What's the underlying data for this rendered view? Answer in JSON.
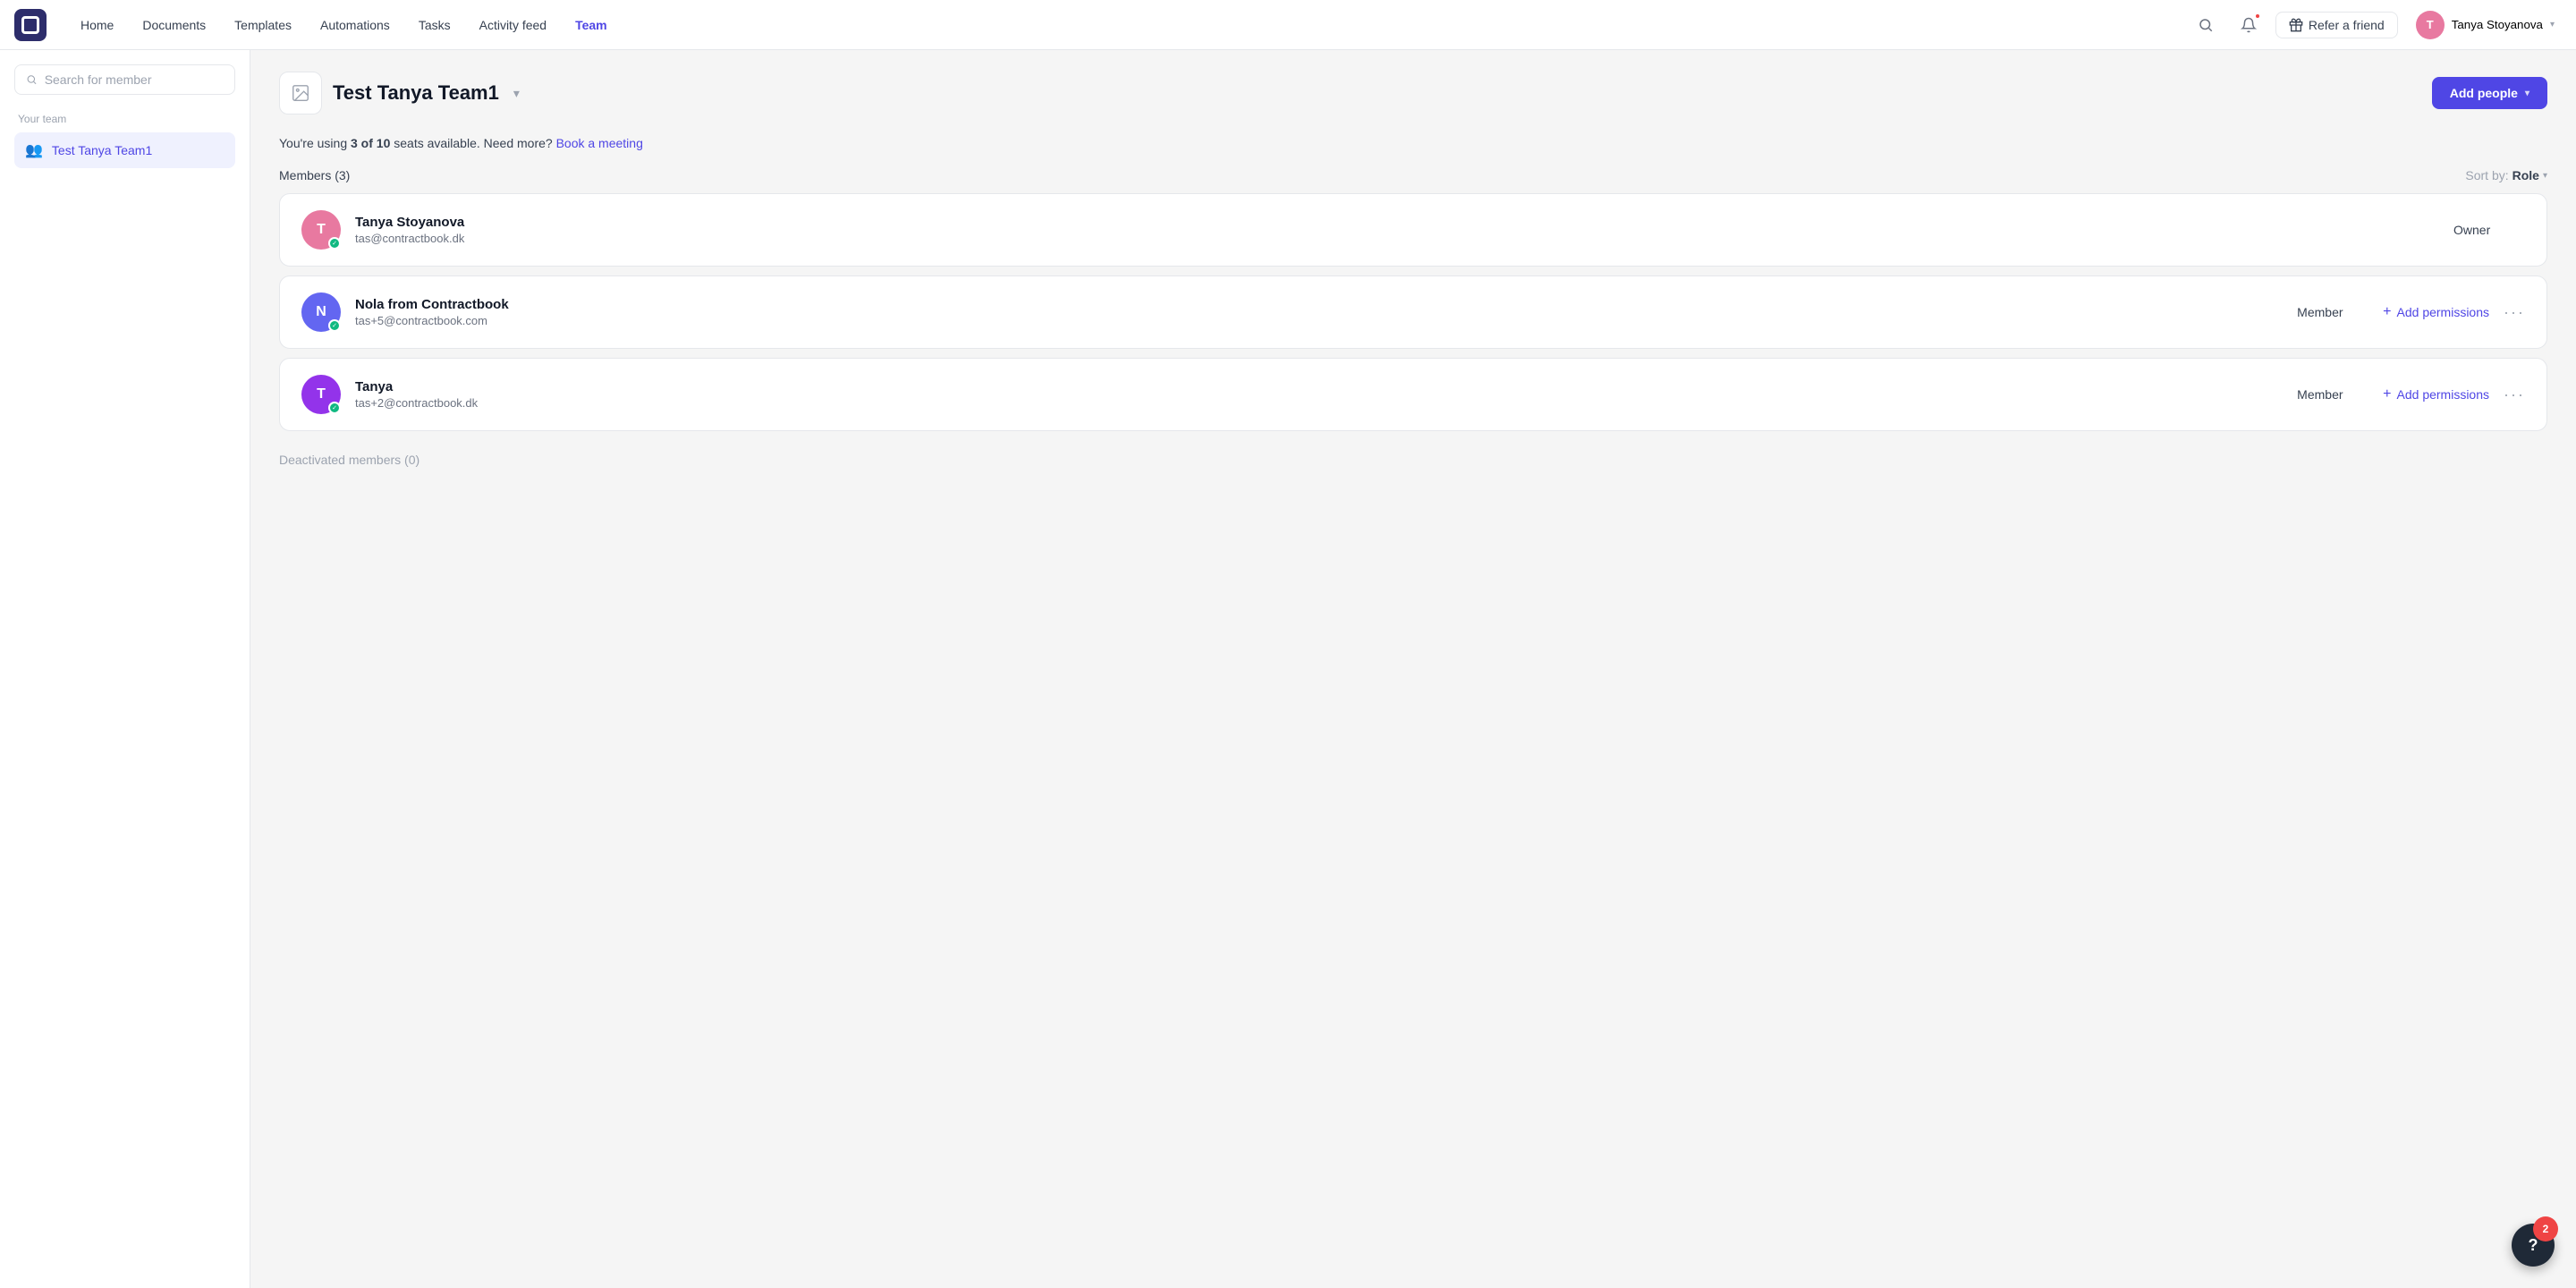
{
  "app": {
    "logo_label": "Contractbook"
  },
  "nav": {
    "items": [
      {
        "id": "home",
        "label": "Home",
        "active": false
      },
      {
        "id": "documents",
        "label": "Documents",
        "active": false
      },
      {
        "id": "templates",
        "label": "Templates",
        "active": false
      },
      {
        "id": "automations",
        "label": "Automations",
        "active": false
      },
      {
        "id": "tasks",
        "label": "Tasks",
        "active": false
      },
      {
        "id": "activity_feed",
        "label": "Activity feed",
        "active": false
      },
      {
        "id": "team",
        "label": "Team",
        "active": true
      }
    ]
  },
  "topnav_right": {
    "refer_label": "Refer a friend",
    "user_name": "Tanya Stoyanova",
    "user_initial": "T"
  },
  "sidebar": {
    "search_placeholder": "Search for member",
    "section_label": "Your team",
    "team_item": {
      "label": "Test Tanya Team1",
      "icon": "👥",
      "active": true
    }
  },
  "main": {
    "team_icon": "🖼",
    "team_name": "Test Tanya Team1",
    "add_people_label": "Add people",
    "seats_text_prefix": "You're using ",
    "seats_used": "3 of 10",
    "seats_text_suffix": " seats available. Need more?",
    "book_meeting_label": "Book a meeting",
    "members_label": "Members (3)",
    "sort_label": "Sort by: ",
    "sort_value": "Role",
    "members": [
      {
        "id": "member1",
        "name": "Tanya Stoyanova",
        "email": "tas@contractbook.dk",
        "role": "Owner",
        "initial": "T",
        "avatar_class": "pink-t",
        "show_actions": false
      },
      {
        "id": "member2",
        "name": "Nola from Contractbook",
        "email": "tas+5@contractbook.com",
        "role": "Member",
        "initial": "N",
        "avatar_class": "purple-n",
        "show_actions": true,
        "add_permissions_label": "Add permissions"
      },
      {
        "id": "member3",
        "name": "Tanya",
        "email": "tas+2@contractbook.dk",
        "role": "Member",
        "initial": "T",
        "avatar_class": "purple-t2",
        "show_actions": true,
        "add_permissions_label": "Add permissions"
      }
    ],
    "deactivated_label": "Deactivated members (0)"
  },
  "help": {
    "count": "2",
    "label": "?"
  }
}
